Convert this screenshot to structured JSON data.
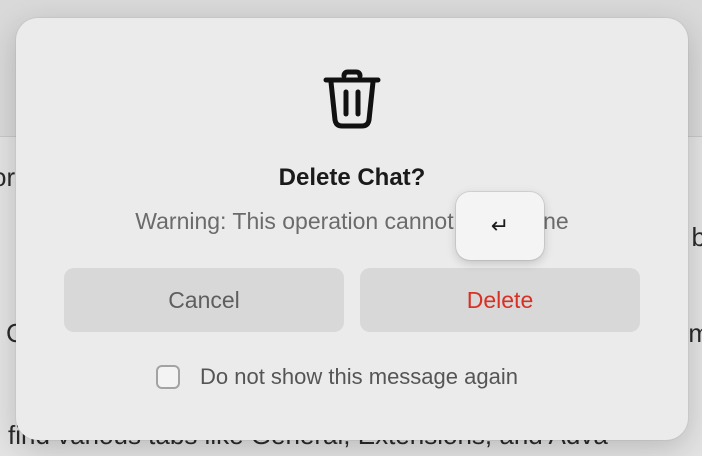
{
  "background": {
    "line_left_1": "or",
    "line_left_2": ":",
    "line_left_3": "C",
    "line_right_1": "b",
    "line_right_2": "m",
    "line_bottom": "find various tabs like General, Extensions, and Adva"
  },
  "dialog": {
    "icon": "trash-icon",
    "title": "Delete Chat?",
    "warning": "Warning: This operation cannot be undone",
    "cancel_label": "Cancel",
    "delete_label": "Delete",
    "checkbox_label": "Do not show this message again",
    "checkbox_checked": false,
    "delete_color": "#d93025"
  },
  "key_hint": {
    "glyph": "↵",
    "icon": "return-key-icon"
  }
}
